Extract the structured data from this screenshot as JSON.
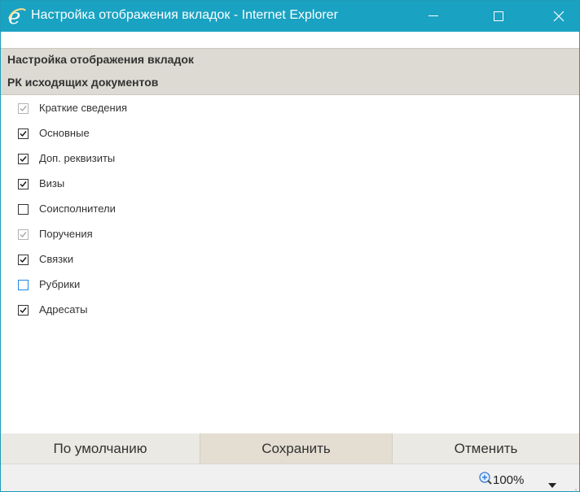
{
  "window": {
    "title": "Настройка отображения вкладок - Internet Explorer",
    "title_color": "#1aa2c2"
  },
  "headers": {
    "panel_title": "Настройка отображения вкладок",
    "section_title": "РК исходящих документов"
  },
  "tabs": [
    {
      "label": "Краткие сведения",
      "checked": true,
      "disabled": true
    },
    {
      "label": "Основные",
      "checked": true,
      "disabled": false
    },
    {
      "label": "Доп. реквизиты",
      "checked": true,
      "disabled": false
    },
    {
      "label": "Визы",
      "checked": true,
      "disabled": false
    },
    {
      "label": "Соисполнители",
      "checked": false,
      "disabled": false
    },
    {
      "label": "Поручения",
      "checked": true,
      "disabled": true
    },
    {
      "label": "Связки",
      "checked": true,
      "disabled": false
    },
    {
      "label": "Рубрики",
      "checked": false,
      "disabled": false,
      "focused": true
    },
    {
      "label": "Адресаты",
      "checked": true,
      "disabled": false
    }
  ],
  "footer": {
    "default_label": "По умолчанию",
    "save_label": "Сохранить",
    "cancel_label": "Отменить"
  },
  "status": {
    "zoom": "100%"
  }
}
